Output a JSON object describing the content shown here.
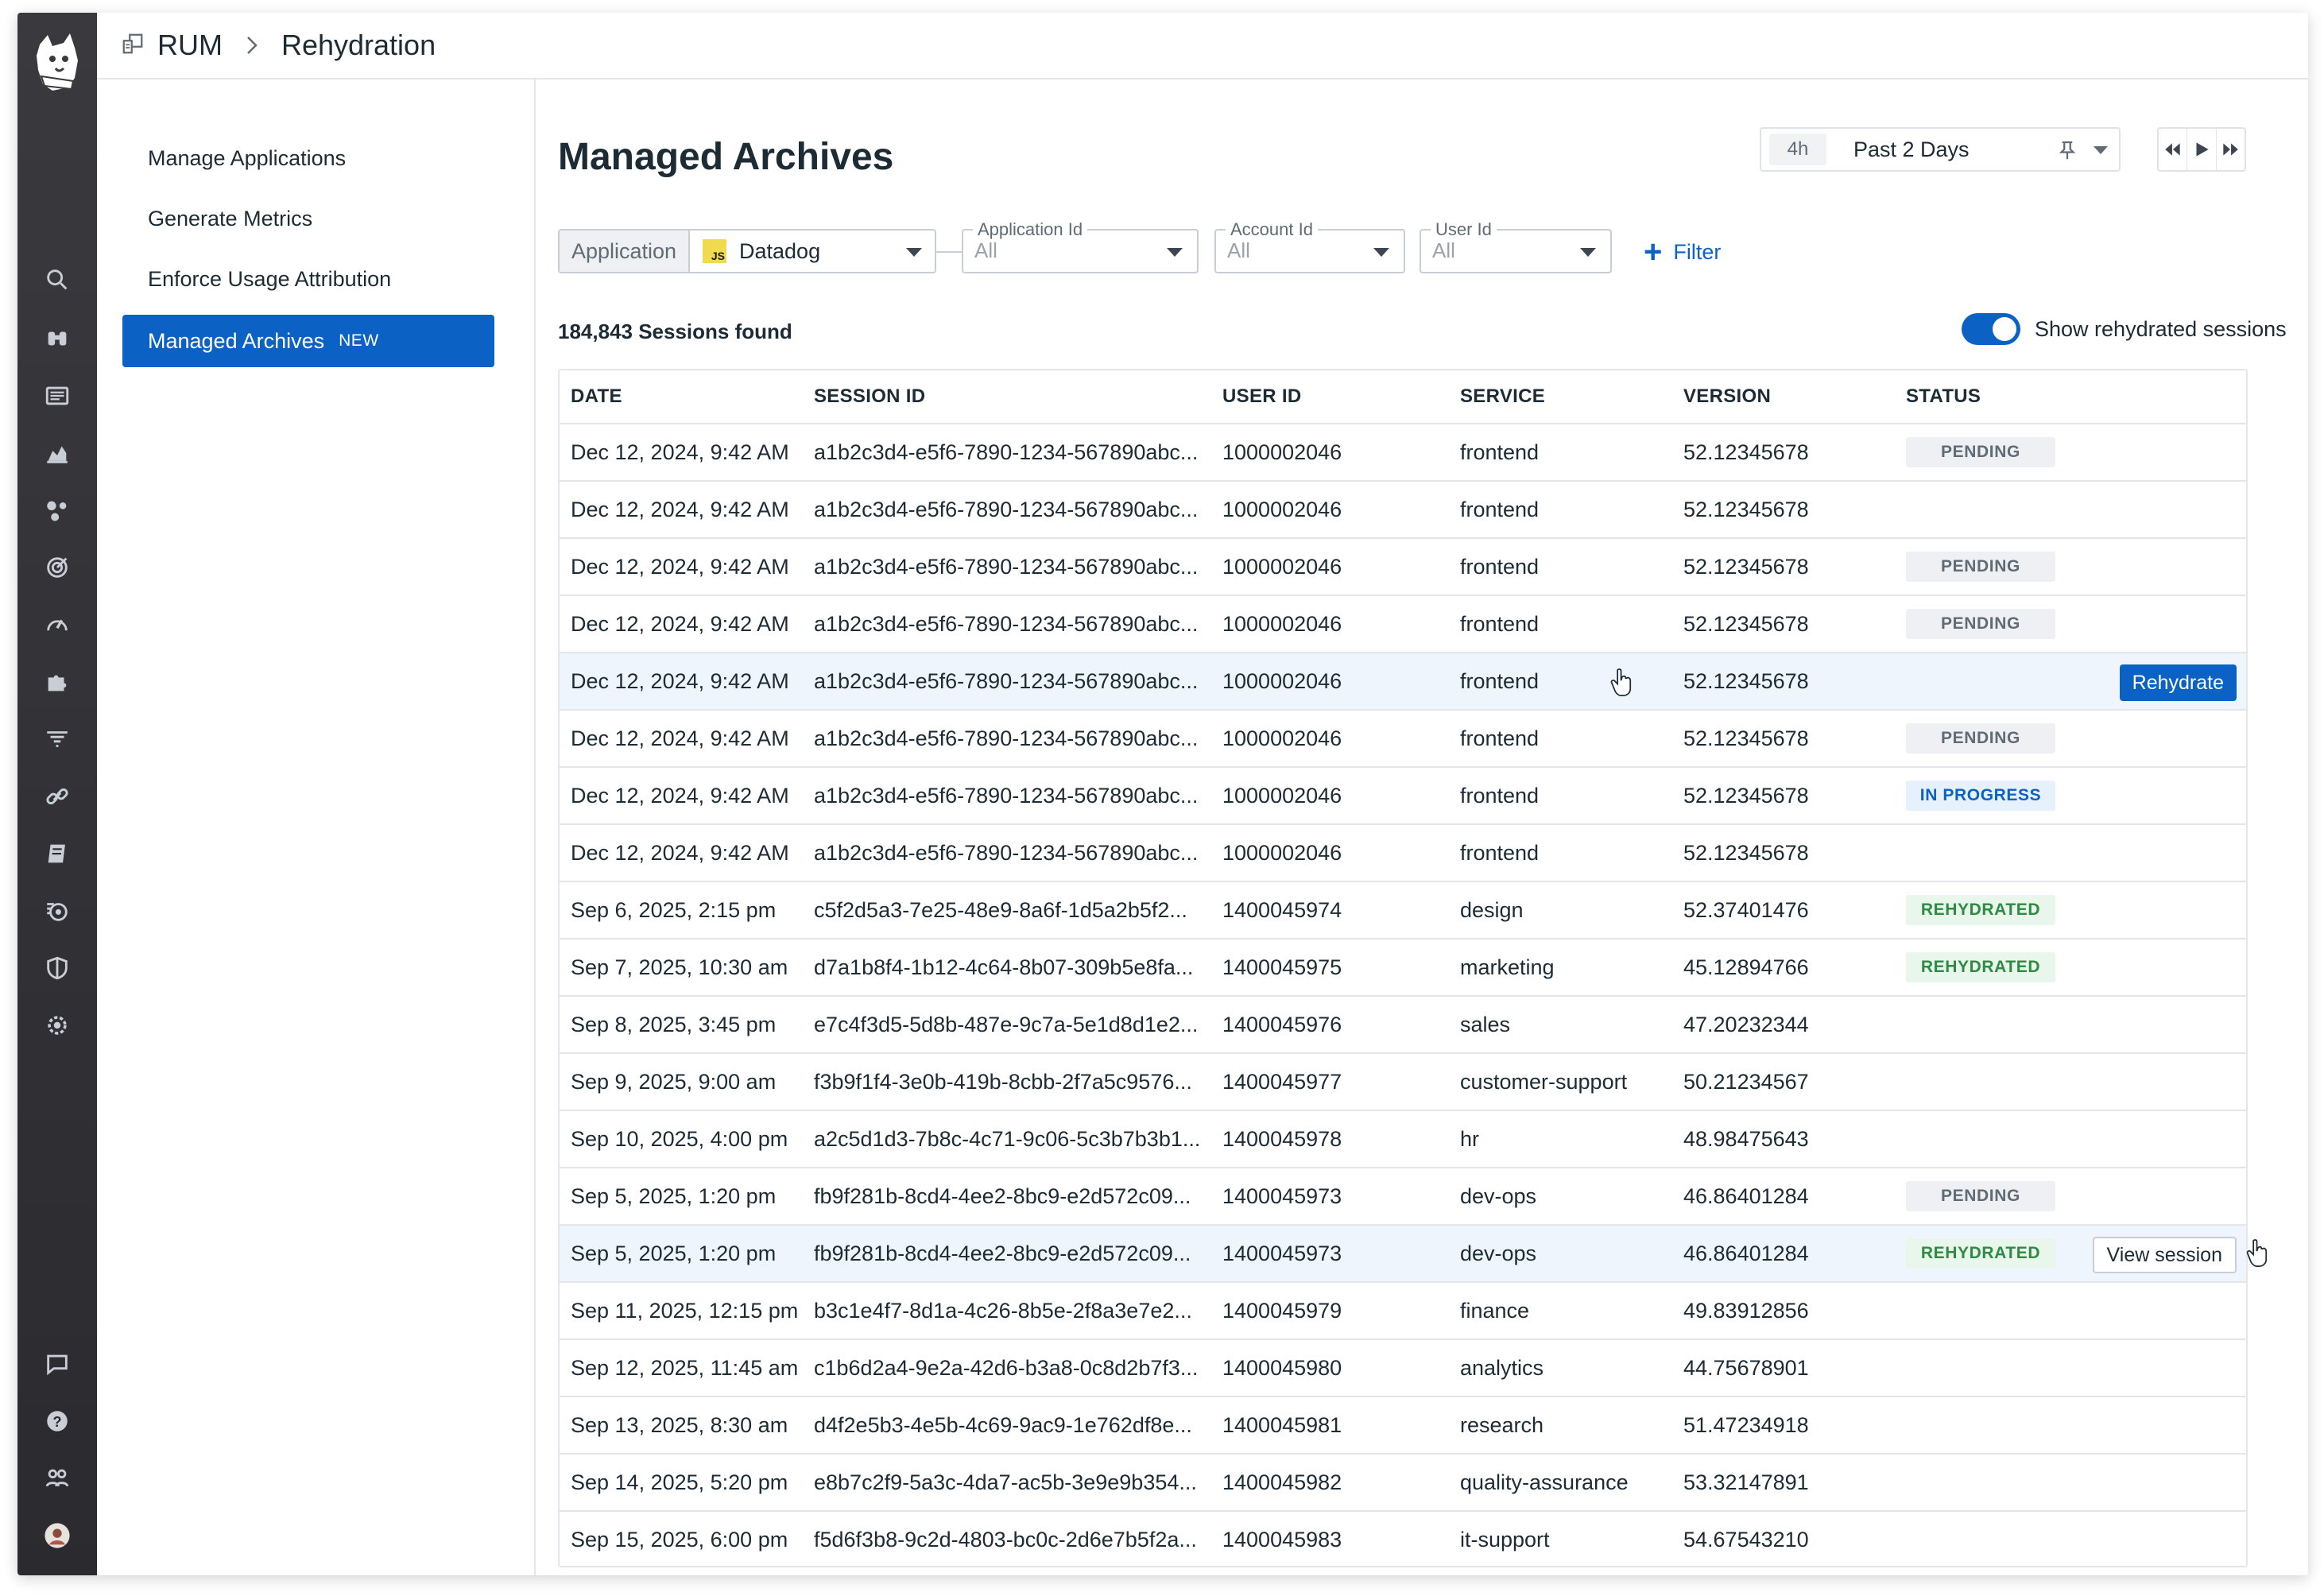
{
  "breadcrumb": {
    "root": "RUM",
    "current": "Rehydration"
  },
  "subnav": {
    "items": [
      {
        "label": "Manage Applications"
      },
      {
        "label": "Generate Metrics"
      },
      {
        "label": "Enforce Usage Attribution"
      },
      {
        "label": "Managed Archives",
        "badge": "NEW",
        "active": true
      }
    ]
  },
  "page": {
    "title": "Managed Archives"
  },
  "timepicker": {
    "badge": "4h",
    "label": "Past 2 Days"
  },
  "filters": {
    "application": {
      "label": "Application",
      "value": "Datadog",
      "icon": "JS"
    },
    "application_id": {
      "label": "Application Id",
      "value": "All"
    },
    "account_id": {
      "label": "Account Id",
      "value": "All"
    },
    "user_id": {
      "label": "User Id",
      "value": "All"
    },
    "add_filter": "Filter"
  },
  "summary": {
    "count_text": "184,843 Sessions found"
  },
  "toggle": {
    "label": "Show rehydrated sessions",
    "on": true
  },
  "table": {
    "columns": [
      "DATE",
      "SESSION ID",
      "USER ID",
      "SERVICE",
      "VERSION",
      "STATUS"
    ],
    "rows": [
      {
        "date": "Dec 12, 2024, 9:42 AM",
        "session_id": "a1b2c3d4-e5f6-7890-1234-567890abc...",
        "user_id": "1000002046",
        "service": "frontend",
        "version": "52.12345678",
        "status": "PENDING"
      },
      {
        "date": "Dec 12, 2024, 9:42 AM",
        "session_id": "a1b2c3d4-e5f6-7890-1234-567890abc...",
        "user_id": "1000002046",
        "service": "frontend",
        "version": "52.12345678",
        "status": ""
      },
      {
        "date": "Dec 12, 2024, 9:42 AM",
        "session_id": "a1b2c3d4-e5f6-7890-1234-567890abc...",
        "user_id": "1000002046",
        "service": "frontend",
        "version": "52.12345678",
        "status": "PENDING"
      },
      {
        "date": "Dec 12, 2024, 9:42 AM",
        "session_id": "a1b2c3d4-e5f6-7890-1234-567890abc...",
        "user_id": "1000002046",
        "service": "frontend",
        "version": "52.12345678",
        "status": "PENDING"
      },
      {
        "date": "Dec 12, 2024, 9:42 AM",
        "session_id": "a1b2c3d4-e5f6-7890-1234-567890abc...",
        "user_id": "1000002046",
        "service": "frontend",
        "version": "52.12345678",
        "status": "",
        "action": "Rehydrate"
      },
      {
        "date": "Dec 12, 2024, 9:42 AM",
        "session_id": "a1b2c3d4-e5f6-7890-1234-567890abc...",
        "user_id": "1000002046",
        "service": "frontend",
        "version": "52.12345678",
        "status": "PENDING"
      },
      {
        "date": "Dec 12, 2024, 9:42 AM",
        "session_id": "a1b2c3d4-e5f6-7890-1234-567890abc...",
        "user_id": "1000002046",
        "service": "frontend",
        "version": "52.12345678",
        "status": "IN PROGRESS"
      },
      {
        "date": "Dec 12, 2024, 9:42 AM",
        "session_id": "a1b2c3d4-e5f6-7890-1234-567890abc...",
        "user_id": "1000002046",
        "service": "frontend",
        "version": "52.12345678",
        "status": ""
      },
      {
        "date": "Sep 6, 2025, 2:15 pm",
        "session_id": "c5f2d5a3-7e25-48e9-8a6f-1d5a2b5f2...",
        "user_id": "1400045974",
        "service": "design",
        "version": "52.37401476",
        "status": "REHYDRATED"
      },
      {
        "date": "Sep 7, 2025, 10:30 am",
        "session_id": "d7a1b8f4-1b12-4c64-8b07-309b5e8fa...",
        "user_id": "1400045975",
        "service": "marketing",
        "version": "45.12894766",
        "status": "REHYDRATED"
      },
      {
        "date": "Sep 8, 2025, 3:45 pm",
        "session_id": "e7c4f3d5-5d8b-487e-9c7a-5e1d8d1e2...",
        "user_id": "1400045976",
        "service": "sales",
        "version": "47.20232344",
        "status": ""
      },
      {
        "date": "Sep 9, 2025, 9:00 am",
        "session_id": "f3b9f1f4-3e0b-419b-8cbb-2f7a5c9576...",
        "user_id": "1400045977",
        "service": "customer-support",
        "version": "50.21234567",
        "status": ""
      },
      {
        "date": "Sep 10, 2025, 4:00 pm",
        "session_id": "a2c5d1d3-7b8c-4c71-9c06-5c3b7b3b1...",
        "user_id": "1400045978",
        "service": "hr",
        "version": "48.98475643",
        "status": ""
      },
      {
        "date": "Sep 5, 2025, 1:20 pm",
        "session_id": "fb9f281b-8cd4-4ee2-8bc9-e2d572c09...",
        "user_id": "1400045973",
        "service": "dev-ops",
        "version": "46.86401284",
        "status": "PENDING"
      },
      {
        "date": "Sep 5, 2025, 1:20 pm",
        "session_id": "fb9f281b-8cd4-4ee2-8bc9-e2d572c09...",
        "user_id": "1400045973",
        "service": "dev-ops",
        "version": "46.86401284",
        "status": "REHYDRATED",
        "action": "View session"
      },
      {
        "date": "Sep 11, 2025, 12:15 pm",
        "session_id": "b3c1e4f7-8d1a-4c26-8b5e-2f8a3e7e2...",
        "user_id": "1400045979",
        "service": "finance",
        "version": "49.83912856",
        "status": ""
      },
      {
        "date": "Sep 12, 2025, 11:45 am",
        "session_id": "c1b6d2a4-9e2a-42d6-b3a8-0c8d2b7f3...",
        "user_id": "1400045980",
        "service": "analytics",
        "version": "44.75678901",
        "status": ""
      },
      {
        "date": "Sep 13, 2025, 8:30 am",
        "session_id": "d4f2e5b3-4e5b-4c69-9ac9-1e762df8e...",
        "user_id": "1400045981",
        "service": "research",
        "version": "51.47234918",
        "status": ""
      },
      {
        "date": "Sep 14, 2025, 5:20 pm",
        "session_id": "e8b7c2f9-5a3c-4da7-ac5b-3e9e9b354...",
        "user_id": "1400045982",
        "service": "quality-assurance",
        "version": "53.32147891",
        "status": ""
      },
      {
        "date": "Sep 15, 2025, 6:00 pm",
        "session_id": "f5d6f3b8-9c2d-4803-bc0c-2d6e7b5f2a...",
        "user_id": "1400045983",
        "service": "it-support",
        "version": "54.67543210",
        "status": ""
      }
    ]
  },
  "nav_icons": [
    "search-icon",
    "binoculars-icon",
    "logs-icon",
    "chart-icon",
    "services-icon",
    "target-icon",
    "gauge-icon",
    "puzzle-icon",
    "filter-icon",
    "link-icon",
    "notebook-icon",
    "watchdog-icon",
    "shield-icon",
    "gear-icon",
    "chat-icon",
    "help-icon",
    "team-icon",
    "user-avatar"
  ],
  "colors": {
    "accent": "#0b62c4",
    "nav_bg": "#2b2b2f",
    "pending_bg": "#eef0f3",
    "rehydrated_text": "#2f8a43"
  }
}
